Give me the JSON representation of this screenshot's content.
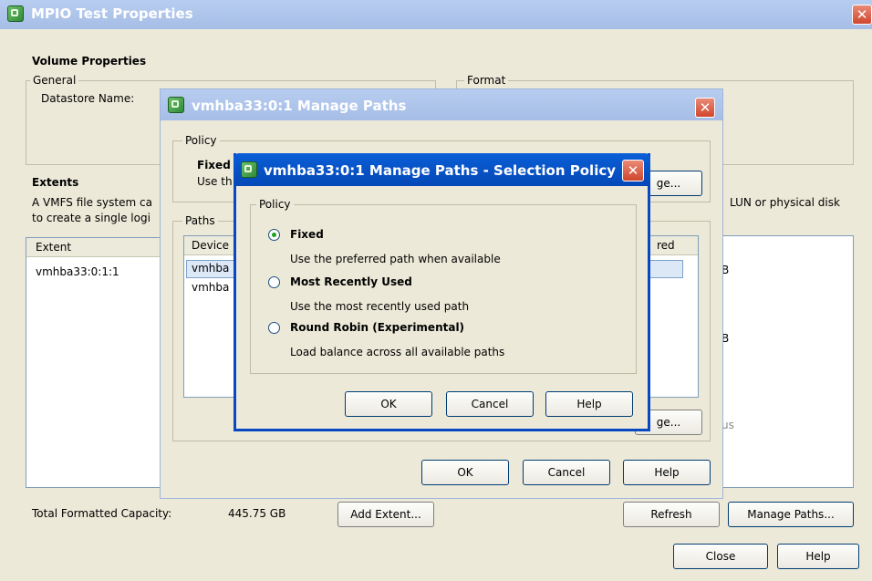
{
  "main_window": {
    "title": "MPIO Test Properties",
    "close_glyph": "✕",
    "volume_properties_heading": "Volume Properties",
    "general_label": "General",
    "datastore_name_label": "Datastore Name:",
    "format_label": "Format",
    "extents_heading": "Extents",
    "extents_description_line1": "A VMFS file system ca",
    "extents_description_line2": "to create a single logi",
    "extents_right_text": "LUN or physical disk",
    "extent_column_header": "Extent",
    "extent_rows": [
      "vmhba33:0:1:1"
    ],
    "total_capacity_label": "Total Formatted Capacity:",
    "total_capacity_value": "445.75 GB",
    "add_extent_button": "Add Extent...",
    "refresh_button": "Refresh",
    "manage_paths_button": "Manage Paths...",
    "close_button": "Close",
    "help_button": "Help"
  },
  "manage_paths_dialog": {
    "title": "vmhba33:0:1 Manage Paths",
    "close_glyph": "✕",
    "policy_group_label": "Policy",
    "policy_value": "Fixed",
    "policy_desc": "Use th",
    "change_button_partial": "ge...",
    "paths_group_label": "Paths",
    "device_column_header": "Device",
    "preferred_column_header": "red",
    "path_rows": [
      "vmhba",
      "vmhba"
    ],
    "change_button2_partial": "ge...",
    "ok_button": "OK",
    "cancel_button": "Cancel",
    "help_button": "Help"
  },
  "selection_policy_dialog": {
    "title": "vmhba33:0:1 Manage Paths - Selection Policy",
    "close_glyph": "✕",
    "policy_group_label": "Policy",
    "options": [
      {
        "label": "Fixed",
        "description": "Use the preferred path when available",
        "selected": true
      },
      {
        "label": "Most Recently Used",
        "description": "Use the most recently used path",
        "selected": false
      },
      {
        "label": "Round Robin (Experimental)",
        "description": "Load balance across all available paths",
        "selected": false
      }
    ],
    "ok_button": "OK",
    "cancel_button": "Cancel",
    "help_button": "Help"
  },
  "colors": {
    "title_active": "#0855c9",
    "title_inactive": "#a6bde6",
    "dialog_bg": "#ece9d8",
    "close_red": "#d0462c"
  }
}
